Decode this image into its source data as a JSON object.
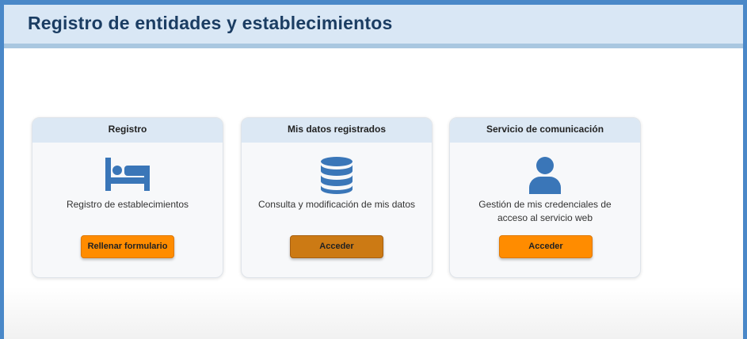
{
  "header": {
    "title": "Registro de entidades y establecimientos"
  },
  "cards": [
    {
      "title": "Registro",
      "icon": "bed-icon",
      "description": "Registro de establecimientos",
      "button_label": "Rellenar formulario"
    },
    {
      "title": "Mis datos registrados",
      "icon": "database-icon",
      "description": "Consulta y modificación de mis datos",
      "button_label": "Acceder"
    },
    {
      "title": "Servicio de comunicación",
      "icon": "user-icon",
      "description": "Gestión de mis credenciales de acceso al servicio web",
      "button_label": "Acceder"
    }
  ],
  "colors": {
    "title": "#1b3d63",
    "header_bg": "#d9e7f5",
    "icon": "#3a76b8",
    "button_orange": "#ff8c00",
    "button_pressed": "#cc7a14"
  }
}
